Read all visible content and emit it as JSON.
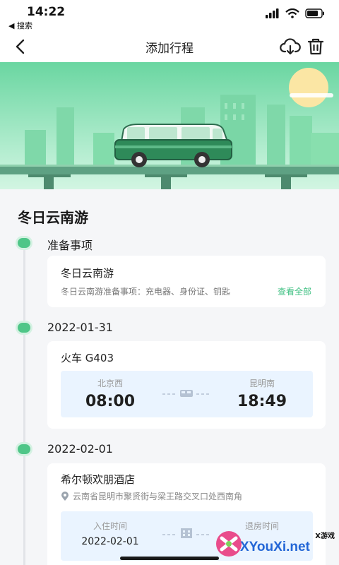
{
  "status_bar": {
    "time": "14:22",
    "back_app": "◀ 搜索"
  },
  "nav": {
    "title": "添加行程"
  },
  "trip": {
    "title": "冬日云南游"
  },
  "sections": {
    "prep": {
      "label": "准备事项",
      "card_title": "冬日云南游",
      "description": "冬日云南游准备事项：充电器、身份证、钥匙",
      "view_all": "查看全部"
    },
    "day1": {
      "date": "2022-01-31",
      "train_name": "火车 G403",
      "from_station": "北京西",
      "to_station": "昆明南",
      "depart_time": "08:00",
      "arrive_time": "18:49"
    },
    "day2": {
      "date": "2022-02-01",
      "hotel_name": "希尔顿欢朋酒店",
      "address": "云南省昆明市聚贤街与梁王路交叉口处西南角",
      "checkin_label": "入住时间",
      "checkin_date": "2022-02-01",
      "checkout_label": "退房时间"
    }
  },
  "watermark": {
    "brand": "XYouXi.net",
    "tag": "X游戏"
  },
  "colors": {
    "accent": "#42c184",
    "timeline_dot": "#4fc688",
    "hero_top": "#6ad6a1",
    "card_panel": "#eaf4ff"
  }
}
